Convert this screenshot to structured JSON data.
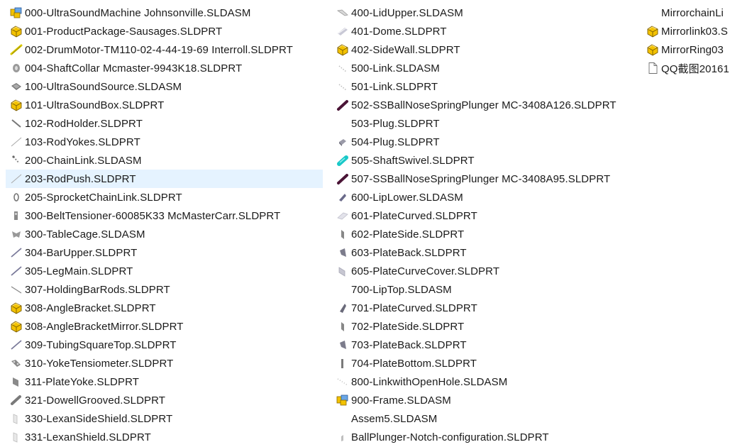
{
  "columns": [
    {
      "items": [
        {
          "name": "000-UltraSoundMachine  Johnsonville.SLDASM",
          "icon": "assembly-icon"
        },
        {
          "name": "001-ProductPackage-Sausages.SLDPRT",
          "icon": "part-yellow-icon"
        },
        {
          "name": "002-DrumMotor-TM110-02-4-44-19-69  Interroll.SLDPRT",
          "icon": "drum-motor-icon"
        },
        {
          "name": "004-ShaftCollar  Mcmaster-9943K18.SLDPRT",
          "icon": "collar-icon"
        },
        {
          "name": "100-UltraSoundSource.SLDASM",
          "icon": "source-icon"
        },
        {
          "name": "101-UltraSoundBox.SLDPRT",
          "icon": "part-yellow-icon"
        },
        {
          "name": "102-RodHolder.SLDPRT",
          "icon": "rod-holder-icon"
        },
        {
          "name": "103-RodYokes.SLDPRT",
          "icon": "thin-rod-icon"
        },
        {
          "name": "200-ChainLink.SLDASM",
          "icon": "chain-link-icon"
        },
        {
          "name": "203-RodPush.SLDPRT",
          "icon": "thin-rod-icon",
          "selected": true
        },
        {
          "name": "205-SprocketChainLink.SLDPRT",
          "icon": "sprocket-icon"
        },
        {
          "name": "300-BeltTensioner-60085K33  McMasterCarr.SLDPRT",
          "icon": "tensioner-icon"
        },
        {
          "name": "300-TableCage.SLDASM",
          "icon": "cage-icon"
        },
        {
          "name": "304-BarUpper.SLDPRT",
          "icon": "bar-icon"
        },
        {
          "name": "305-LegMain.SLDPRT",
          "icon": "bar-icon"
        },
        {
          "name": "307-HoldingBarRods.SLDPRT",
          "icon": "rods-icon"
        },
        {
          "name": "308-AngleBracket.SLDPRT",
          "icon": "part-yellow-icon"
        },
        {
          "name": "308-AngleBracketMirror.SLDPRT",
          "icon": "part-yellow-icon"
        },
        {
          "name": "309-TubingSquareTop.SLDPRT",
          "icon": "bar-icon"
        },
        {
          "name": "310-YokeTensiometer.SLDPRT",
          "icon": "yoke-icon"
        },
        {
          "name": "311-PlateYoke.SLDPRT",
          "icon": "plate-icon"
        },
        {
          "name": "321-DowellGrooved.SLDPRT",
          "icon": "dowel-icon"
        },
        {
          "name": "330-LexanSideShield.SLDPRT",
          "icon": "shield-icon"
        },
        {
          "name": "331-LexanShield.SLDPRT",
          "icon": "shield-icon"
        }
      ]
    },
    {
      "items": [
        {
          "name": "400-LidUpper.SLDASM",
          "icon": "lid-icon"
        },
        {
          "name": "401-Dome.SLDPRT",
          "icon": "dome-icon"
        },
        {
          "name": "402-SideWall.SLDPRT",
          "icon": "part-yellow-icon"
        },
        {
          "name": "500-Link.SLDASM",
          "icon": "link-icon"
        },
        {
          "name": "501-Link.SLDPRT",
          "icon": "link-icon"
        },
        {
          "name": "502-SSBallNoseSpringPlunger  MC-3408A126.SLDPRT",
          "icon": "plunger-icon"
        },
        {
          "name": "503-Plug.SLDPRT",
          "icon": "blank-icon"
        },
        {
          "name": "504-Plug.SLDPRT",
          "icon": "plug-icon"
        },
        {
          "name": "505-ShaftSwivel.SLDPRT",
          "icon": "swivel-icon"
        },
        {
          "name": "507-SSBallNoseSpringPlunger  MC-3408A95.SLDPRT",
          "icon": "plunger-icon"
        },
        {
          "name": "600-LipLower.SLDASM",
          "icon": "lip-icon"
        },
        {
          "name": "601-PlateCurved.SLDPRT",
          "icon": "curved-plate-light-icon"
        },
        {
          "name": "602-PlateSide.SLDPRT",
          "icon": "plate-side-icon"
        },
        {
          "name": "603-PlateBack.SLDPRT",
          "icon": "plate-back-icon"
        },
        {
          "name": "605-PlateCurveCover.SLDPRT",
          "icon": "curve-cover-icon"
        },
        {
          "name": "700-LipTop.SLDASM",
          "icon": "blank-icon"
        },
        {
          "name": "701-PlateCurved.SLDPRT",
          "icon": "curved-plate-icon"
        },
        {
          "name": "702-PlateSide.SLDPRT",
          "icon": "plate-side-icon"
        },
        {
          "name": "703-PlateBack.SLDPRT",
          "icon": "plate-back-icon"
        },
        {
          "name": "704-PlateBottom.SLDPRT",
          "icon": "plate-bottom-icon"
        },
        {
          "name": "800-LinkwithOpenHole.SLDASM",
          "icon": "dotted-link-icon"
        },
        {
          "name": "900-Frame.SLDASM",
          "icon": "assembly-icon"
        },
        {
          "name": "Assem5.SLDASM",
          "icon": "blank-icon"
        },
        {
          "name": "BallPlunger-Notch-configuration.SLDPRT",
          "icon": "small-plunger-icon"
        }
      ]
    },
    {
      "items": [
        {
          "name": "MirrorchainLi",
          "icon": "blank-icon"
        },
        {
          "name": "Mirrorlink03.S",
          "icon": "part-yellow-icon"
        },
        {
          "name": "MirrorRing03",
          "icon": "part-yellow-icon"
        },
        {
          "name": "QQ截图20161",
          "icon": "document-icon"
        }
      ]
    }
  ]
}
